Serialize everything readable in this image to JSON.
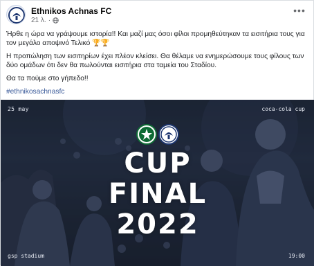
{
  "post": {
    "page_name": "Ethnikos Achnas FC",
    "time": "21 λ.",
    "paragraphs": [
      "Ήρθε η ώρα να γράψουμε ιστορία!! Και μαζί μας όσοι φίλοι προμηθεύτηκαν τα εισιτήρια τους για τον μεγάλο αποψινό Τελικό 🏆🏆",
      "Η προπώληση των εισιτηρίων έχει πλέον κλείσει. Θα θέλαμε να ενημερώσουμε τους φίλους των δύο ομάδων ότι δεν θα πωλούνται εισιτήρια στα ταμεία του Σταδίου.",
      "Θα τα πούμε στο γήπεδο!!"
    ],
    "hashtag": "#ethnikosachnasfc"
  },
  "image": {
    "date": "25 may",
    "competition": "coca-cola cup",
    "title_line1": "CUP",
    "title_line2": "FINAL",
    "title_line3": "2022",
    "venue": "gsp stadium",
    "kickoff": "19:00"
  },
  "colors": {
    "link": "#385898",
    "meta": "#65676b",
    "omonia_green": "#0f6b35",
    "ethnikos_blue": "#1d3670"
  }
}
